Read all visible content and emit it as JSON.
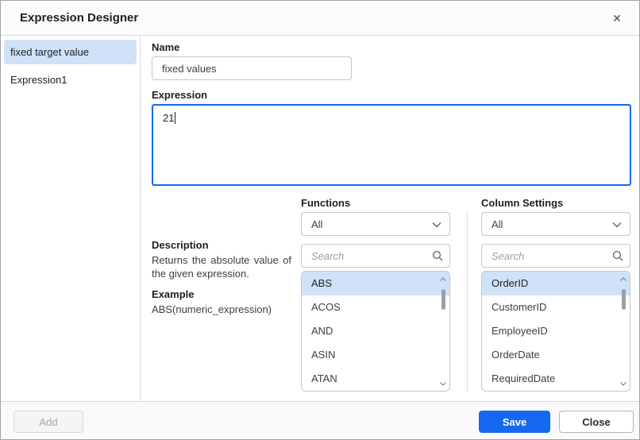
{
  "dialog": {
    "title": "Expression Designer",
    "close_icon": "✕"
  },
  "sidebar": {
    "items": [
      {
        "label": "fixed target value",
        "selected": true
      },
      {
        "label": "Expression1",
        "selected": false
      }
    ]
  },
  "form": {
    "name_label": "Name",
    "name_value": "fixed values",
    "expression_label": "Expression",
    "expression_value": "21"
  },
  "description": {
    "heading": "Description",
    "text": "Returns the absolute value of the given expression.",
    "example_heading": "Example",
    "example_text": "ABS(numeric_expression)"
  },
  "functions": {
    "heading": "Functions",
    "filter_value": "All",
    "search_placeholder": "Search",
    "selected": "ABS",
    "items": [
      "ABS",
      "ACOS",
      "AND",
      "ASIN",
      "ATAN"
    ]
  },
  "columns": {
    "heading": "Column Settings",
    "filter_value": "All",
    "search_placeholder": "Search",
    "selected": "OrderID",
    "items": [
      "OrderID",
      "CustomerID",
      "EmployeeID",
      "OrderDate",
      "RequiredDate"
    ]
  },
  "footer": {
    "add_label": "Add",
    "save_label": "Save",
    "close_label": "Close"
  },
  "colors": {
    "primary_blue": "#1469f0",
    "selection_blue": "#d0e2f8",
    "border_gray": "#c6c6c6"
  }
}
